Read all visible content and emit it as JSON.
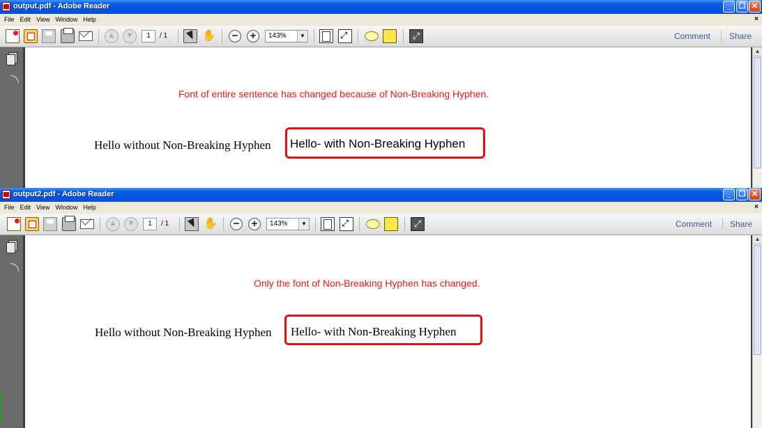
{
  "windows": [
    {
      "title": "output.pdf - Adobe Reader",
      "menu": [
        "File",
        "Edit",
        "View",
        "Window",
        "Help"
      ],
      "toolbar": {
        "page_current": "1",
        "page_total": "/ 1",
        "zoom": "143%",
        "comment_label": "Comment",
        "share_label": "Share"
      },
      "document": {
        "note": "Font of entire sentence has changed because of Non-Breaking Hyphen.",
        "plain_text": "Hello without Non-Breaking Hyphen",
        "boxed_text": "Hello- with Non-Breaking Hyphen"
      }
    },
    {
      "title": "output2.pdf - Adobe Reader",
      "menu": [
        "File",
        "Edit",
        "View",
        "Window",
        "Help"
      ],
      "toolbar": {
        "page_current": "1",
        "page_total": "/ 1",
        "zoom": "143%",
        "comment_label": "Comment",
        "share_label": "Share"
      },
      "document": {
        "note": "Only the font of Non-Breaking Hyphen has changed.",
        "plain_text": "Hello without Non-Breaking Hyphen",
        "boxed_text": "Hello- with Non-Breaking Hyphen"
      }
    }
  ],
  "titlebar_buttons": {
    "minimize": "_",
    "maximize": "❐",
    "close": "✕"
  },
  "menubar_close": "×",
  "colors": {
    "titlebar": "#0054e3",
    "annotation_red": "#e41a1a",
    "link_blue": "#3b5c8c"
  }
}
